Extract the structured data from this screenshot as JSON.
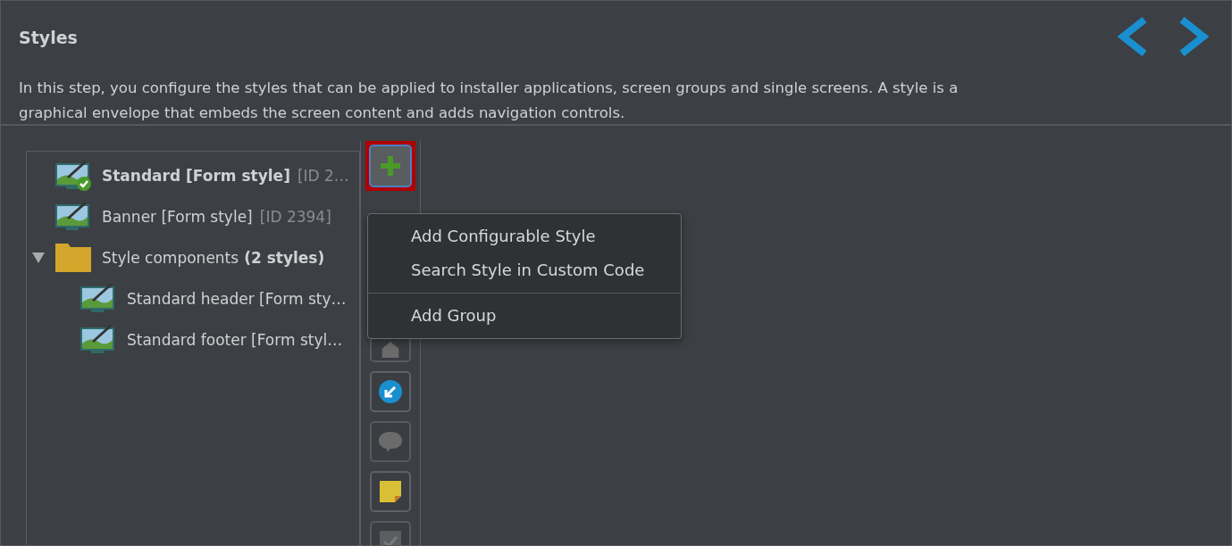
{
  "header": {
    "title": "Styles",
    "description": "In this step, you configure the styles that can be applied to installer applications, screen groups and single screens. A style is a graphical envelope that embeds the screen content and adds navigation controls."
  },
  "tree": {
    "items": [
      {
        "kind": "style",
        "label": "Standard [Form style]",
        "id": "[ID 2…",
        "default": true
      },
      {
        "kind": "style",
        "label": "Banner [Form style]",
        "id": "[ID 2394]",
        "default": false
      },
      {
        "kind": "folder",
        "label": "Style components",
        "count": "(2 styles)",
        "expanded": true,
        "children": [
          {
            "kind": "style",
            "label": "Standard header [Form sty…",
            "default": false
          },
          {
            "kind": "style",
            "label": "Standard footer [Form styl…",
            "default": false
          }
        ]
      }
    ]
  },
  "toolbar": [
    {
      "kind": "add",
      "disabled": false,
      "highlighted": true
    },
    {
      "kind": "house",
      "disabled": true,
      "highlighted": false
    },
    {
      "kind": "reuse",
      "disabled": false,
      "highlighted": false
    },
    {
      "kind": "comment",
      "disabled": true,
      "highlighted": false
    },
    {
      "kind": "note",
      "disabled": false,
      "highlighted": false
    },
    {
      "kind": "check",
      "disabled": true,
      "highlighted": false
    }
  ],
  "menu": [
    [
      "Add Configurable Style",
      "Search Style in Custom Code"
    ],
    [
      "Add Group"
    ]
  ]
}
